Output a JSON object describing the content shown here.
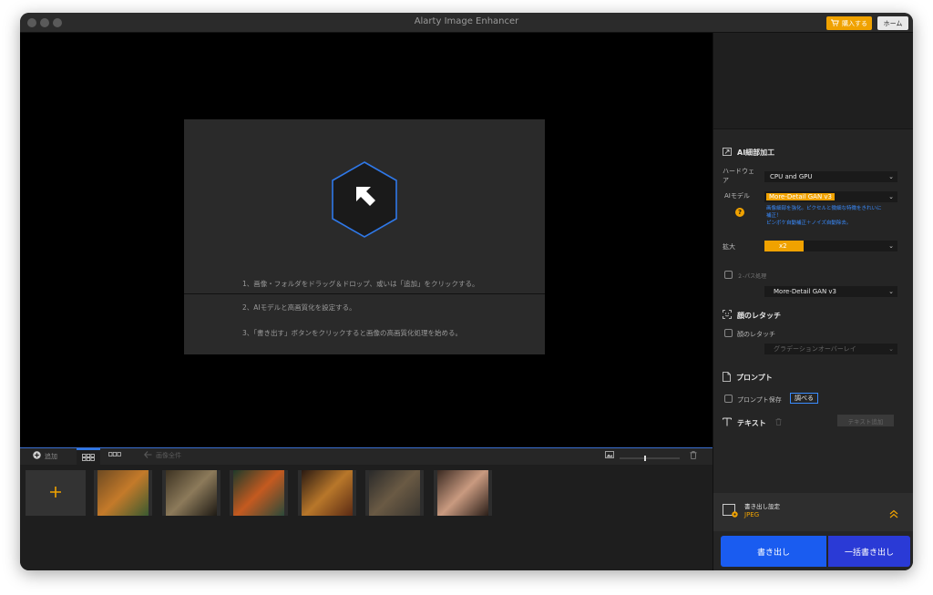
{
  "app": {
    "title": "Alarty Image Enhancer"
  },
  "header": {
    "buy_label": "購入する",
    "home_label": "ホーム"
  },
  "drop": {
    "step1": "1、画像・フォルダをドラッグ＆ドロップ、或いは「追加」をクリックする。",
    "step2": "2、AIモデルと高画質化を設定する。",
    "step3": "3、「書き出す」ボタンをクリックすると画像の高画質化処理を始める。"
  },
  "toolbar": {
    "add_label": "追加",
    "delete_label": "画像全件"
  },
  "thumbnails": [
    {
      "name": "tiger",
      "colors": [
        "#6d4a22",
        "#c47a2a",
        "#3a5a30"
      ]
    },
    {
      "name": "butterfly",
      "colors": [
        "#3d3322",
        "#8c7a5a",
        "#1e1a14"
      ]
    },
    {
      "name": "flowers",
      "colors": [
        "#1f3a2a",
        "#c45a20",
        "#2b4a3a"
      ]
    },
    {
      "name": "burger",
      "colors": [
        "#2a1a12",
        "#b8772a",
        "#5a2a14"
      ]
    },
    {
      "name": "dog",
      "colors": [
        "#2a2a2a",
        "#6a5a44",
        "#3a3630"
      ]
    },
    {
      "name": "portrait",
      "colors": [
        "#3a2a22",
        "#c99a80",
        "#2a1e18"
      ]
    }
  ],
  "sidebar": {
    "ai_section": "AI細部加工",
    "hardware_label": "ハードウェア",
    "hardware_value": "CPU and GPU",
    "model_label": "AIモデル",
    "model_value": "More-Detail GAN v3",
    "model_help_icon": "?",
    "model_desc1": "画像細部を強化。ピクセルと微細な特徴をきれいに",
    "model_desc2": "補正！",
    "model_desc3": "ピンボケ自動補正＋ノイズ自動除去。",
    "scale_label": "拡大",
    "scale_value": "x2",
    "twopass_label": "２-パス処理",
    "twopass_value": "More-Detail GAN v3",
    "face_section": "顔のレタッチ",
    "face_label": "顔のレタッチ",
    "face_value": "グラデーションオーバーレイ",
    "prompt_section": "プロンプト",
    "prompt_save_label": "プロンプト保存",
    "prompt_check_label": "調べる",
    "text_section": "テキスト",
    "text_add_label": "テキスト追加"
  },
  "export": {
    "settings_label": "書き出し設定",
    "format": "JPEG",
    "export_label": "書き出し",
    "batch_label": "一括書き出し"
  },
  "colors": {
    "accent_orange": "#f0a200",
    "accent_blue": "#1a5cf0",
    "batch_blue": "#2a3ad6"
  }
}
